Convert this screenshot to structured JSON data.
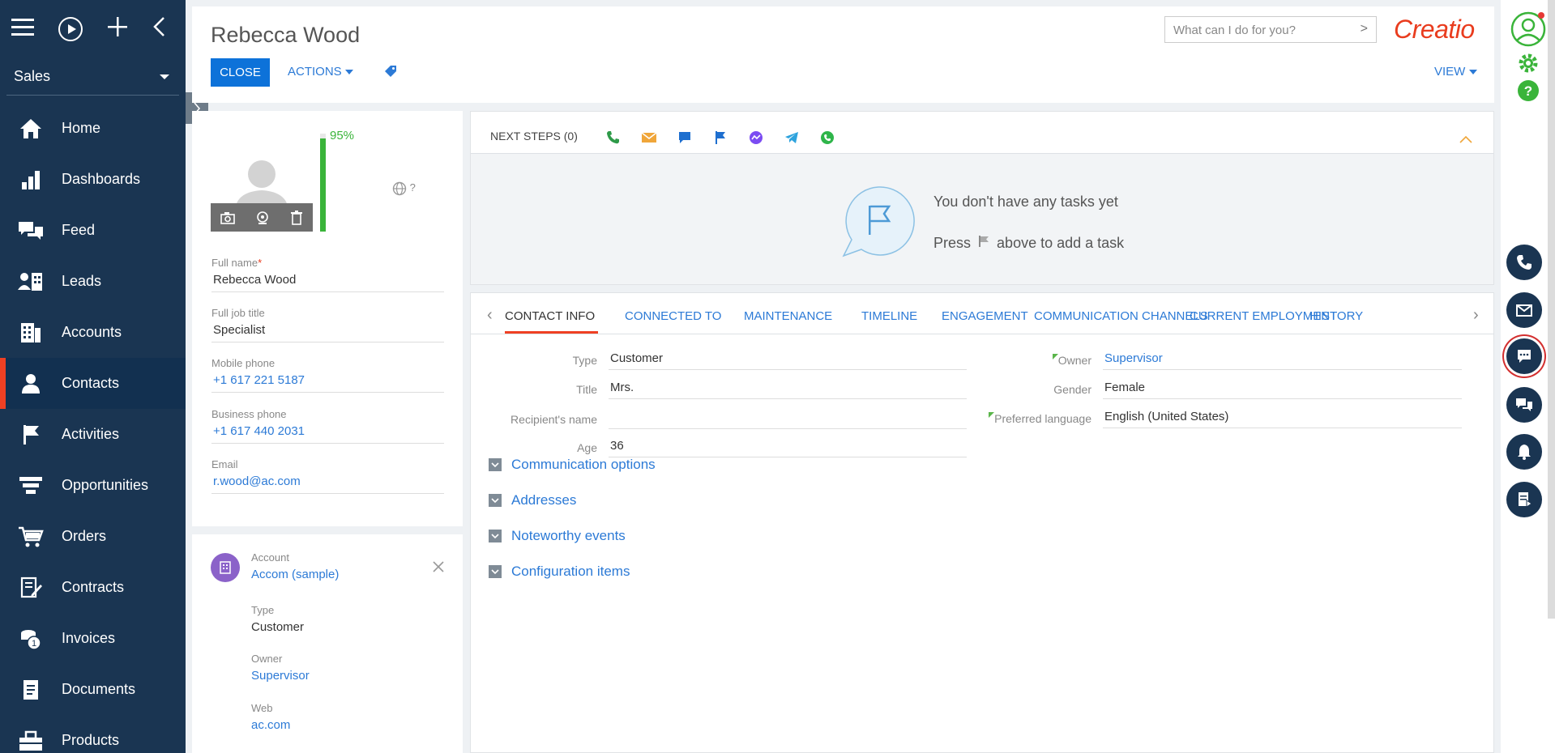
{
  "nav": {
    "workspace": "Sales",
    "items": [
      {
        "label": "Home",
        "icon": "home-icon"
      },
      {
        "label": "Dashboards",
        "icon": "bar-chart-icon"
      },
      {
        "label": "Feed",
        "icon": "chat-icon"
      },
      {
        "label": "Leads",
        "icon": "leads-icon"
      },
      {
        "label": "Accounts",
        "icon": "building-icon"
      },
      {
        "label": "Contacts",
        "icon": "person-icon"
      },
      {
        "label": "Activities",
        "icon": "flag-icon"
      },
      {
        "label": "Opportunities",
        "icon": "funnel-icon"
      },
      {
        "label": "Orders",
        "icon": "cart-icon"
      },
      {
        "label": "Contracts",
        "icon": "contract-icon"
      },
      {
        "label": "Invoices",
        "icon": "coins-icon"
      },
      {
        "label": "Documents",
        "icon": "document-icon"
      },
      {
        "label": "Products",
        "icon": "products-icon"
      }
    ],
    "active": "Contacts"
  },
  "header": {
    "title": "Rebecca Wood",
    "close_label": "CLOSE",
    "actions_label": "ACTIONS",
    "view_label": "VIEW",
    "search_placeholder": "What can I do for you?",
    "logo": "Creatio"
  },
  "profile": {
    "completeness": "95%",
    "completeness_value": 0.95,
    "globe_text": "?",
    "fields": {
      "full_name_label": "Full name",
      "full_name": "Rebecca Wood",
      "job_title_label": "Full job title",
      "job_title": "Specialist",
      "mobile_label": "Mobile phone",
      "mobile": "+1 617 221 5187",
      "business_label": "Business phone",
      "business": "+1 617 440 2031",
      "email_label": "Email",
      "email": "r.wood@ac.com"
    }
  },
  "account": {
    "account_label": "Account",
    "account": "Accom (sample)",
    "type_label": "Type",
    "type": "Customer",
    "owner_label": "Owner",
    "owner": "Supervisor",
    "web_label": "Web",
    "web": "ac.com"
  },
  "next_steps": {
    "label": "NEXT STEPS (0)",
    "empty_line1": "You don't have any tasks yet",
    "empty_line2_pre": "Press",
    "empty_line2_post": "above to add a task"
  },
  "tabs": [
    "CONTACT INFO",
    "CONNECTED TO",
    "MAINTENANCE",
    "TIMELINE",
    "ENGAGEMENT",
    "COMMUNICATION CHANNELS",
    "CURRENT EMPLOYMENT",
    "HISTORY"
  ],
  "contact_info": {
    "type_label": "Type",
    "type": "Customer",
    "title_label": "Title",
    "title": "Mrs.",
    "recipient_label": "Recipient's name",
    "recipient": "",
    "age_label": "Age",
    "age": "36",
    "owner_label": "Owner",
    "owner": "Supervisor",
    "gender_label": "Gender",
    "gender": "Female",
    "language_label": "Preferred language",
    "language": "English (United States)"
  },
  "groups": [
    "Communication options",
    "Addresses",
    "Noteworthy events",
    "Configuration items"
  ],
  "colors": {
    "accent": "#0d72d9",
    "nav_bg": "#1a3552",
    "brand": "#e93c1e",
    "success": "#3ab43a"
  }
}
